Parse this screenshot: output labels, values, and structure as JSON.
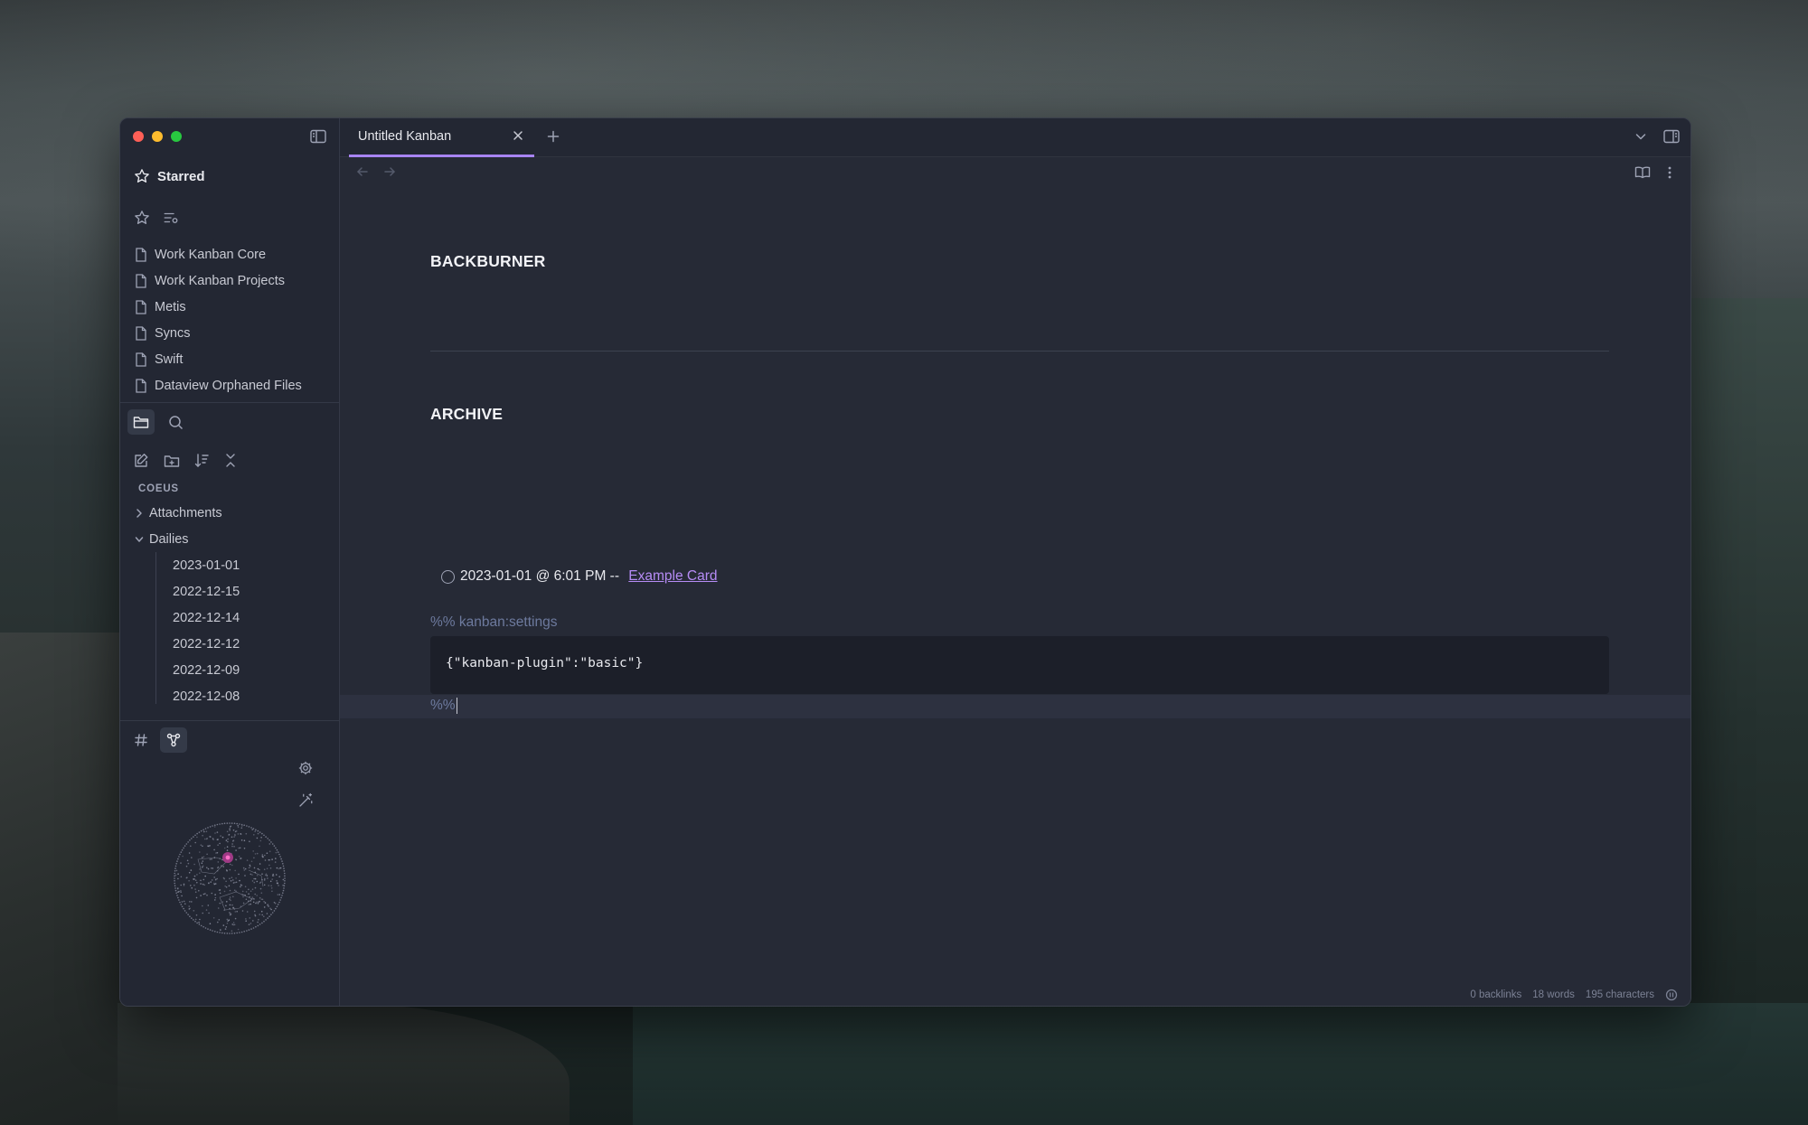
{
  "colors": {
    "accent": "#a884f3",
    "link": "#b68cf6",
    "sidebar_bg": "#232733",
    "editor_bg": "#262a36",
    "code_bg": "#1c1f29",
    "comment": "#6d7a9e"
  },
  "tabs": [
    {
      "label": "Untitled Kanban",
      "active": true,
      "close_icon": "close-icon"
    }
  ],
  "sidebar": {
    "starred": {
      "title": "Starred",
      "items": [
        {
          "label": "Work Kanban Core"
        },
        {
          "label": "Work Kanban Projects"
        },
        {
          "label": "Metis"
        },
        {
          "label": "Syncs"
        },
        {
          "label": "Swift"
        },
        {
          "label": "Dataview Orphaned Files"
        }
      ]
    },
    "explorer": {
      "vault_name": "COEUS",
      "folders": [
        {
          "label": "Attachments",
          "expanded": false
        },
        {
          "label": "Dailies",
          "expanded": true,
          "children": [
            {
              "label": "2023-01-01"
            },
            {
              "label": "2022-12-15"
            },
            {
              "label": "2022-12-14"
            },
            {
              "label": "2022-12-12"
            },
            {
              "label": "2022-12-09"
            },
            {
              "label": "2022-12-08"
            }
          ]
        }
      ]
    }
  },
  "document": {
    "lanes": [
      {
        "title": "BACKBURNER"
      },
      {
        "title": "ARCHIVE"
      }
    ],
    "archive_card": {
      "text": "2023-01-01 @ 6:01 PM -- ",
      "link": "Example Card",
      "checked": false
    },
    "settings_open": "%% kanban:settings",
    "settings_code": "{\"kanban-plugin\":\"basic\"}",
    "settings_close": "%%"
  },
  "status": {
    "backlinks": "0 backlinks",
    "words": "18 words",
    "characters": "195 characters"
  }
}
